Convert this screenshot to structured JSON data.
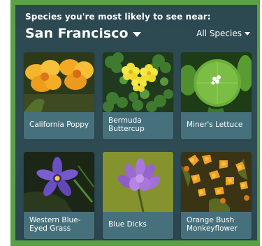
{
  "header": {
    "subtitle": "Species you're most likely to see near:",
    "location": "San Francisco",
    "filter": "All Species"
  },
  "species": [
    {
      "name": "California Poppy"
    },
    {
      "name": "Bermuda Buttercup"
    },
    {
      "name": "Miner's Lettuce"
    },
    {
      "name": "Western Blue-Eyed Grass"
    },
    {
      "name": "Blue Dicks"
    },
    {
      "name": "Orange Bush Monkeyflower"
    }
  ],
  "colors": {
    "frame": "#5aa046",
    "panel": "#2e4a52",
    "card": "#47707d"
  },
  "icons": {
    "location_dropdown": "caret-down-icon",
    "filter_dropdown": "caret-down-icon"
  }
}
